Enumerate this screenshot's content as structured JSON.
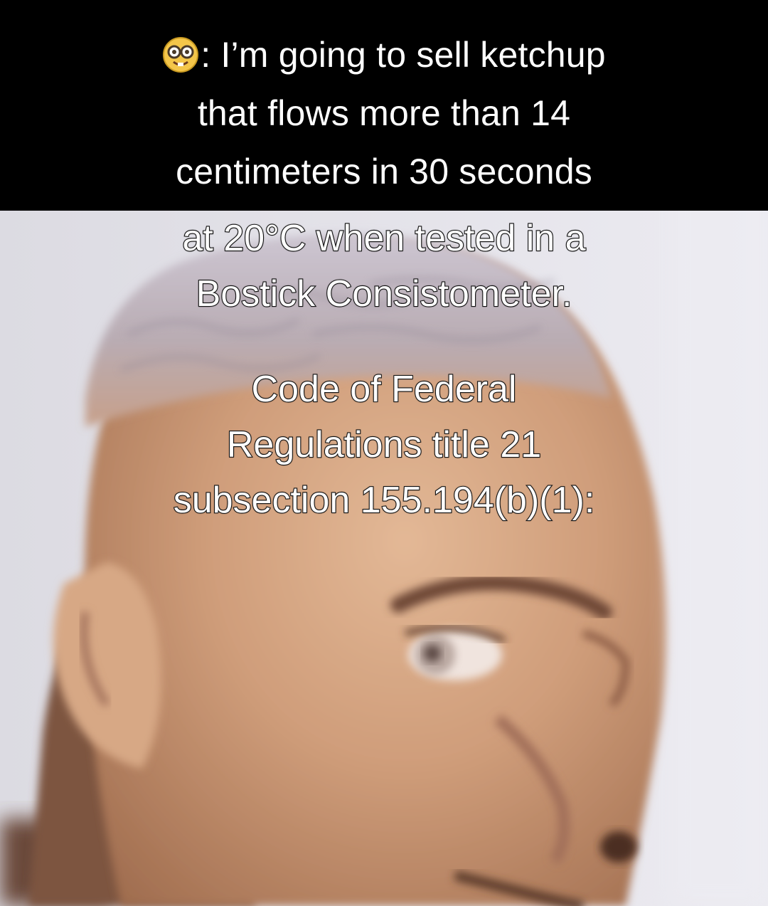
{
  "top_caption": {
    "emoji_icon": "nerd-face-emoji",
    "lines": [
      ": I’m going to sell ketchup",
      "that flows more than 14",
      "centimeters in 30 seconds"
    ]
  },
  "overlay_caption": {
    "lines": [
      "at 20°C when tested in a",
      "Bostick Consistometer."
    ]
  },
  "overlay_caption_2": {
    "lines": [
      "Code of Federal",
      "Regulations title 21",
      "subsection 155.194(b)(1):"
    ]
  },
  "colors": {
    "top_bar": "#000000",
    "text": "#ffffff",
    "skin": "#c99877",
    "background": "#e6e4ea"
  }
}
